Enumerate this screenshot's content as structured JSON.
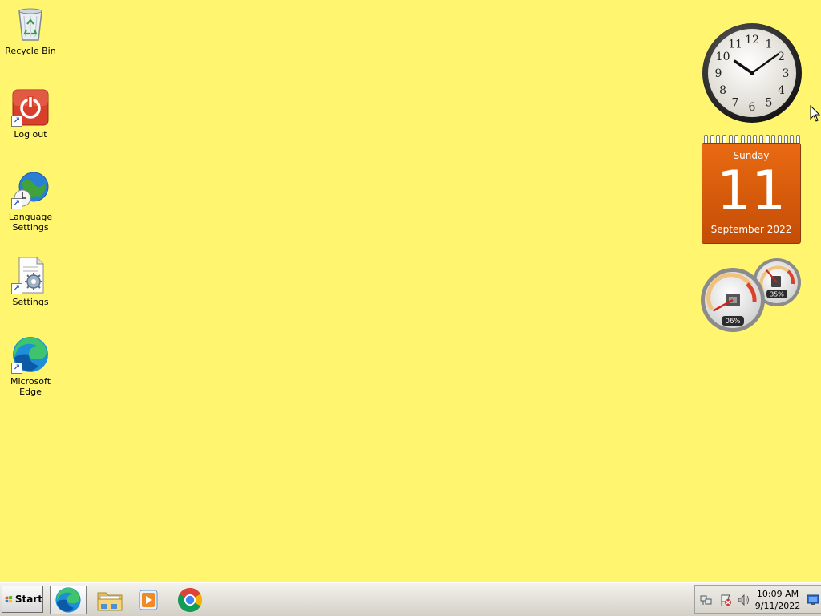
{
  "desktop": {
    "background_color": "#fff56f",
    "icons": [
      {
        "label": "Recycle Bin",
        "icon": "recycle-bin-icon"
      },
      {
        "label": "Log out",
        "icon": "power-icon"
      },
      {
        "label": "Language Settings",
        "icon": "globe-clock-icon"
      },
      {
        "label": "Settings",
        "icon": "settings-document-icon"
      },
      {
        "label": "Microsoft Edge",
        "icon": "edge-icon"
      }
    ]
  },
  "gadgets": {
    "clock": {
      "hour": 10,
      "minute": 9,
      "numerals": [
        "12",
        "1",
        "2",
        "3",
        "4",
        "5",
        "6",
        "7",
        "8",
        "9",
        "10",
        "11"
      ]
    },
    "calendar": {
      "weekday": "Sunday",
      "day": "11",
      "month_year": "September 2022",
      "color": "#e2600f"
    },
    "cpu_meter": {
      "cpu_percent": "06%",
      "memory_percent": "35%",
      "cpu_value": 6,
      "memory_value": 35
    }
  },
  "taskbar": {
    "start_label": "Start",
    "apps": [
      {
        "name": "Microsoft Edge",
        "icon": "edge-icon",
        "active": true
      },
      {
        "name": "Windows Explorer",
        "icon": "folder-icon",
        "active": false
      },
      {
        "name": "Windows Media Player",
        "icon": "media-player-icon",
        "active": false
      },
      {
        "name": "Google Chrome",
        "icon": "chrome-icon",
        "active": false
      }
    ],
    "tray": {
      "time": "10:09 AM",
      "date": "9/11/2022",
      "icons": [
        "network-icon",
        "action-center-flag-icon",
        "volume-icon",
        "show-desktop-icon"
      ]
    }
  }
}
